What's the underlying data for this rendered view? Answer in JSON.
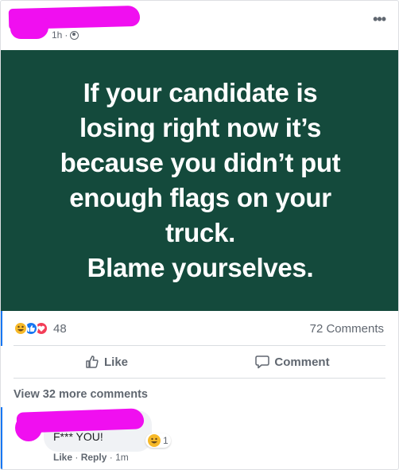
{
  "post": {
    "time": "1h",
    "separator": "·",
    "privacy_icon": "globe-icon",
    "menu_label": "•••",
    "image_lines": [
      "If your candidate is",
      "losing right now it’s",
      "because you didn’t put",
      "enough flags on your",
      "truck.",
      "Blame yourselves."
    ],
    "image_bg_color": "#144a3c"
  },
  "stats": {
    "reaction_icons": [
      "haha-icon",
      "like-icon",
      "love-icon"
    ],
    "reaction_count": "48",
    "comment_count": "72 Comments"
  },
  "actions": {
    "like_label": "Like",
    "comment_label": "Comment"
  },
  "comments": {
    "view_more": "View 32 more comments",
    "items": [
      {
        "text": "F*** YOU!",
        "reaction_count": "1",
        "like_label": "Like",
        "reply_label": "Reply",
        "time": "1m"
      }
    ]
  },
  "colors": {
    "accent_blue": "#1877f2",
    "redaction_magenta": "#f00ff0",
    "muted_text": "#606770"
  }
}
